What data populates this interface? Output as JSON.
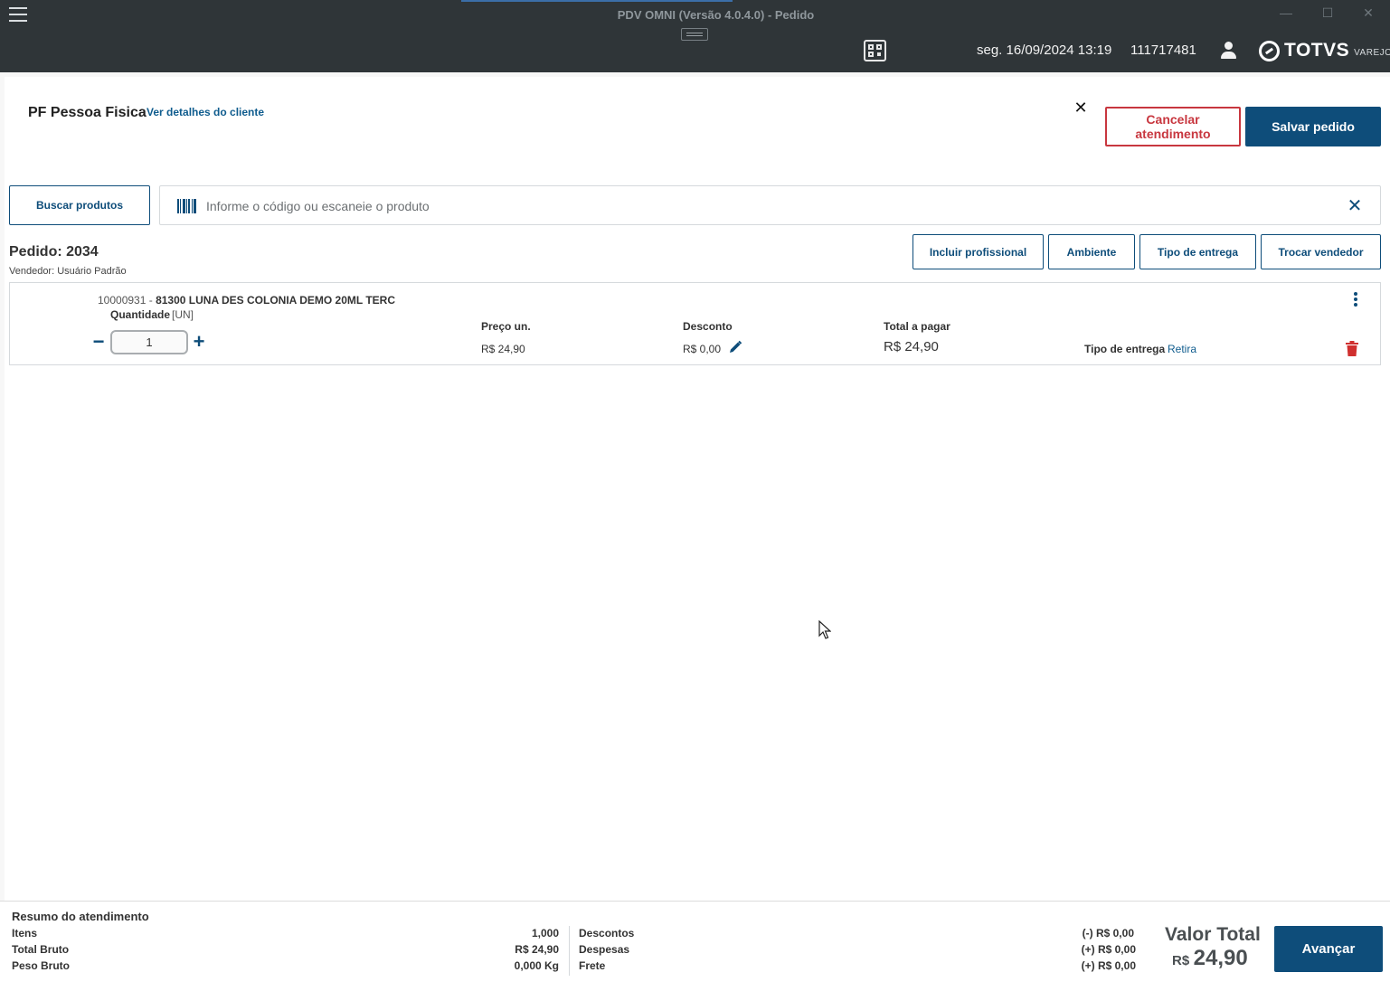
{
  "window": {
    "title": "PDV OMNI (Versão 4.0.4.0) - Pedido",
    "minimize_glyph": "—",
    "maximize_glyph": "☐",
    "close_glyph": "✕"
  },
  "header": {
    "datetime": "seg. 16/09/2024 13:19",
    "terminal_id": "111717481",
    "logo_brand": "TOTVS",
    "logo_sub": "VAREJO"
  },
  "client": {
    "name": "PF Pessoa Fisica",
    "details_link": "Ver detalhes do cliente",
    "close_glyph": "✕"
  },
  "actions": {
    "cancel_label": "Cancelar atendimento",
    "save_label": "Salvar pedido"
  },
  "search": {
    "button_label": "Buscar produtos",
    "placeholder": "Informe o código ou escaneie o produto",
    "clear_glyph": "✕"
  },
  "order": {
    "title": "Pedido: 2034",
    "seller": "Vendedor: Usuário Padrão",
    "buttons": {
      "professional": "Incluir profissional",
      "environment": "Ambiente",
      "delivery_type": "Tipo de entrega",
      "change_seller": "Trocar vendedor"
    }
  },
  "item": {
    "code": "10000931",
    "separator": "-",
    "ref_and_name": "81300  LUNA DES COLONIA DEMO 20ML TERC",
    "quantity_label": "Quantidade",
    "unit": "[UN]",
    "quantity": "1",
    "minus_glyph": "−",
    "plus_glyph": "+",
    "price_label": "Preço un.",
    "price": "R$ 24,90",
    "discount_label": "Desconto",
    "discount": "R$ 0,00",
    "total_label": "Total a pagar",
    "total": "R$ 24,90",
    "delivery_label": "Tipo de entrega",
    "delivery_value": "Retira"
  },
  "summary": {
    "title": "Resumo do atendimento",
    "items_label": "Itens",
    "items_value": "1,000",
    "gross_label": "Total Bruto",
    "gross_value": "R$ 24,90",
    "weight_label": "Peso Bruto",
    "weight_value": "0,000 Kg",
    "discounts_label": "Descontos",
    "discounts_value": "(-) R$ 0,00",
    "expenses_label": "Despesas",
    "expenses_value": "(+) R$ 0,00",
    "freight_label": "Frete",
    "freight_value": "(+) R$ 0,00",
    "total_label": "Valor Total",
    "total_currency": "R$",
    "total_value": "24,90",
    "advance_label": "Avançar"
  },
  "colors": {
    "titlebar": "#2f3538",
    "primary": "#0e4d7a",
    "danger": "#c8373f",
    "link": "#0f5c8e"
  },
  "icons": [
    "hamburger-icon",
    "qr-code-icon",
    "user-icon",
    "totvs-logo-icon",
    "barcode-icon",
    "close-icon",
    "edit-pencil-icon",
    "kebab-menu-icon",
    "trash-icon",
    "cursor-arrow-icon"
  ]
}
